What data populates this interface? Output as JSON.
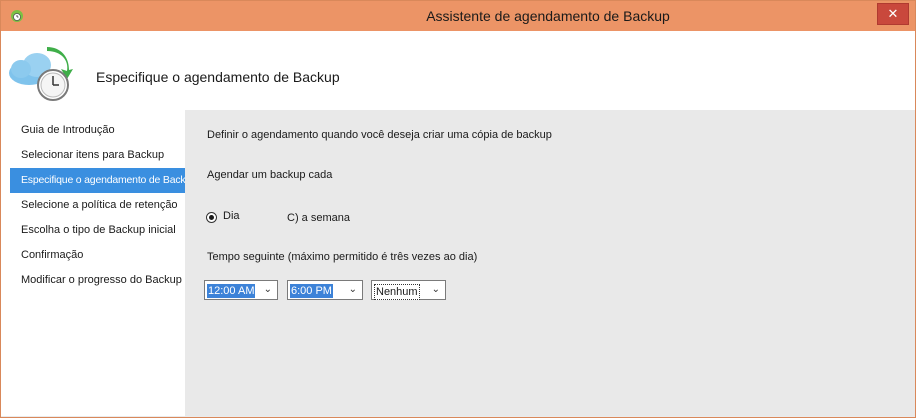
{
  "window": {
    "title": "Assistente de agendamento de Backup",
    "close_label": "✕"
  },
  "header": {
    "title": "Especifique o agendamento de Backup"
  },
  "nav": {
    "items": [
      {
        "label": "Guia de Introdução"
      },
      {
        "label": "Selecionar itens para Backup"
      },
      {
        "label": "Especifique o agendamento de Backup",
        "active": true
      },
      {
        "label": "Selecione a política de retenção"
      },
      {
        "label": "Escolha o tipo de Backup inicial"
      },
      {
        "label": "Confirmação"
      },
      {
        "label": "Modificar o progresso do Backup"
      }
    ]
  },
  "main": {
    "intro": "Definir o agendamento quando você deseja criar uma cópia de backup",
    "schedule_label": "Agendar um backup cada",
    "radio_day": "Dia",
    "radio_week": "C) a semana",
    "times_label": "Tempo seguinte (máximo permitido é três vezes ao dia)",
    "time1": "12:00 AM",
    "time2": "6:00 PM",
    "time3": "Nenhum",
    "arrow": "⌄"
  },
  "colors": {
    "titlebar": "#ec9466",
    "accent": "#3a8fe0",
    "close": "#c9483c"
  },
  "icons": {
    "app": "cloud-clock-icon",
    "header": "cloud-clock-icon"
  }
}
